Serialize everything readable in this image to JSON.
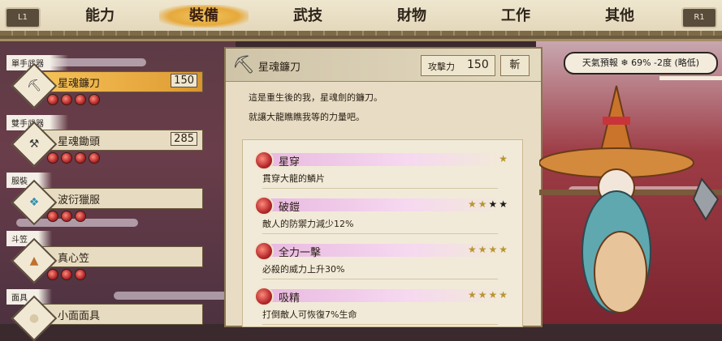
{
  "nav": {
    "left_button": "L1",
    "right_button": "R1",
    "tabs": [
      {
        "label": "能力",
        "active": false
      },
      {
        "label": "裝備",
        "active": true
      },
      {
        "label": "武技",
        "active": false
      },
      {
        "label": "財物",
        "active": false
      },
      {
        "label": "工作",
        "active": false
      },
      {
        "label": "其他",
        "active": false
      }
    ]
  },
  "equipment": [
    {
      "category": "單手武器",
      "name": "星魂鐮刀",
      "value": "150",
      "gems": 4,
      "icon": "sickle-icon",
      "selected": true
    },
    {
      "category": "雙手武器",
      "name": "星魂鋤頭",
      "value": "285",
      "gems": 4,
      "icon": "hoe-icon",
      "selected": false
    },
    {
      "category": "服裝",
      "name": "波衍獵服",
      "value": "",
      "gems": 3,
      "icon": "clothing-icon",
      "selected": false
    },
    {
      "category": "斗笠",
      "name": "真心笠",
      "value": "",
      "gems": 3,
      "icon": "hat-icon",
      "selected": false
    },
    {
      "category": "面具",
      "name": "小面面具",
      "value": "",
      "gems": 0,
      "icon": "mask-icon",
      "selected": false
    }
  ],
  "detail": {
    "name": "星魂鐮刀",
    "icon": "sickle-icon",
    "attack_label": "攻擊力",
    "attack_value": "150",
    "type": "斬",
    "description": [
      "這是重生後的我，星魂劍的鐮刀。",
      "就讓大龍瞧瞧我等的力量吧。"
    ],
    "skills": [
      {
        "name": "星穿",
        "desc": "貫穿大龍的鱗片",
        "stars_gold": 1,
        "stars_dark": 0
      },
      {
        "name": "破鎧",
        "desc": "敵人的防禦力減少12%",
        "stars_gold": 2,
        "stars_dark": 2
      },
      {
        "name": "全力一擊",
        "desc": "必殺的威力上升30%",
        "stars_gold": 4,
        "stars_dark": 0
      },
      {
        "name": "吸精",
        "desc": "打倒敵人可恢復7%生命",
        "stars_gold": 4,
        "stars_dark": 0
      }
    ]
  },
  "weather": {
    "text": "天氣預報 ❄ 69% -2度 (略低)"
  },
  "colors": {
    "accent": "#e6a93c",
    "gem": "#b4282c",
    "panel": "#e8ddc4"
  }
}
